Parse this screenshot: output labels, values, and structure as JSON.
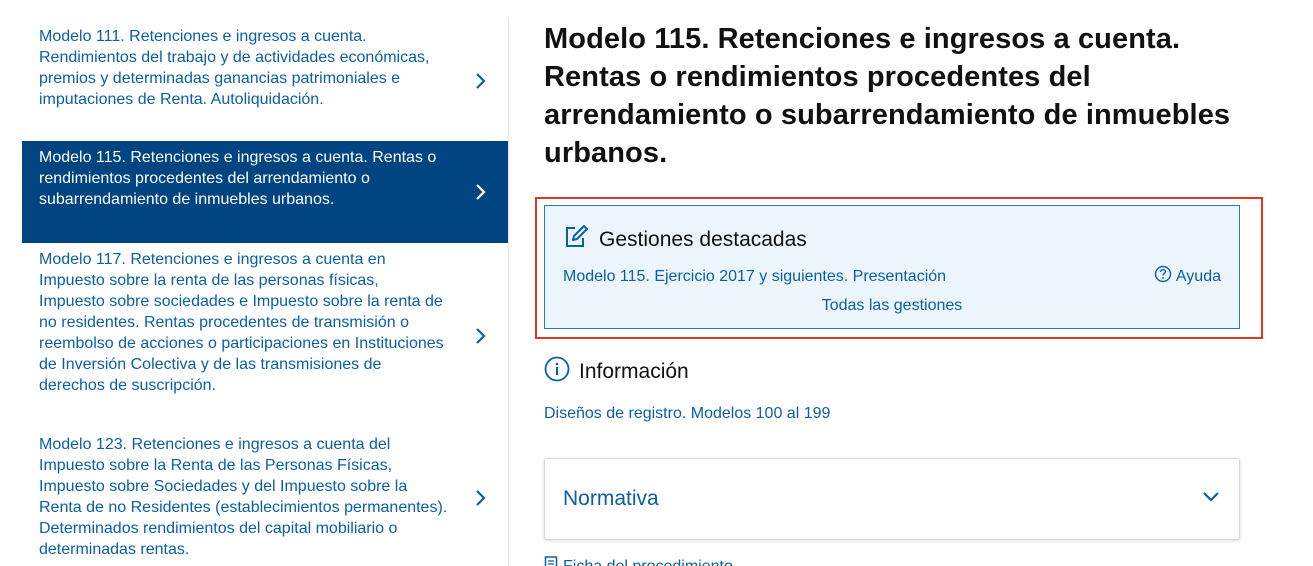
{
  "sidebar": {
    "items": [
      {
        "label": "Modelo 111. Retenciones e ingresos a cuenta. Rendimientos del trabajo y de actividades económicas, premios y determinadas ganancias patrimoniales e imputaciones de Renta. Autoliquidación.",
        "active": false
      },
      {
        "label": "Modelo 115. Retenciones e ingresos a cuenta. Rentas o rendimientos procedentes del arrendamiento o subarrendamiento de inmuebles urbanos.",
        "active": true
      },
      {
        "label": "Modelo 117. Retenciones e ingresos a cuenta en Impuesto sobre la renta de las personas físicas, Impuesto sobre sociedades e Impuesto sobre la renta de no residentes. Rentas procedentes de transmisión o reembolso de acciones o participaciones en Instituciones de Inversión Colectiva y de las transmisiones de derechos de suscripción.",
        "active": false
      },
      {
        "label": "Modelo 123. Retenciones e ingresos a cuenta del Impuesto sobre la Renta de las Personas Físicas, Impuesto sobre Sociedades y del Impuesto sobre la Renta de no Residentes (establecimientos permanentes). Determinados rendimientos del capital mobiliario o determinadas rentas.",
        "active": false
      }
    ]
  },
  "main": {
    "title": "Modelo 115. Retenciones e ingresos a cuenta. Rentas o rendimientos procedentes del arrendamiento o subarrendamiento de inmuebles urbanos.",
    "gestiones": {
      "title": "Gestiones destacadas",
      "link": "Modelo 115. Ejercicio 2017 y siguientes. Presentación",
      "help": "Ayuda",
      "all": "Todas las gestiones"
    },
    "info": {
      "title": "Información",
      "link": "Diseños de registro. Modelos 100 al 199"
    },
    "normativa": {
      "label": "Normativa"
    },
    "ficha": "Ficha del procedimiento"
  },
  "colors": {
    "link": "#0b5fa8",
    "active_bg": "#004582",
    "highlight_border": "#e0391f",
    "gestiones_bg": "#ebf5fb"
  },
  "icons": [
    "chevron-right-icon",
    "edit-icon",
    "help-circle-icon",
    "info-circle-icon",
    "chevron-down-icon",
    "document-icon"
  ]
}
